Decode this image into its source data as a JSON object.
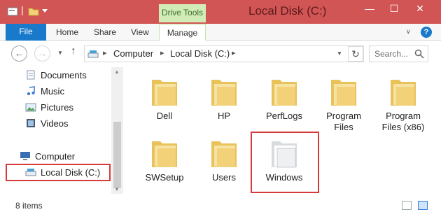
{
  "window": {
    "title": "Local Disk (C:)",
    "context_group": "Drive Tools",
    "accent": "#d25555"
  },
  "ribbon": {
    "file_label": "File",
    "tabs": [
      "Home",
      "Share",
      "View"
    ],
    "manage_label": "Manage"
  },
  "address": {
    "crumbs": [
      "Computer",
      "Local Disk (C:)"
    ],
    "search_placeholder": "Search..."
  },
  "navpane": {
    "items": [
      {
        "label": "Documents",
        "icon": "documents-icon"
      },
      {
        "label": "Music",
        "icon": "music-icon"
      },
      {
        "label": "Pictures",
        "icon": "pictures-icon"
      },
      {
        "label": "Videos",
        "icon": "videos-icon"
      },
      {
        "label": "Computer",
        "icon": "computer-icon"
      },
      {
        "label": "Local Disk (C:)",
        "icon": "drive-icon"
      }
    ]
  },
  "folders": [
    {
      "label": "Dell"
    },
    {
      "label": "HP"
    },
    {
      "label": "PerfLogs"
    },
    {
      "label": "Program\nFiles"
    },
    {
      "label": "Program\nFiles (x86)"
    },
    {
      "label": "SWSetup"
    },
    {
      "label": "Users"
    },
    {
      "label": "Windows"
    }
  ],
  "status": {
    "count_text": "8 items"
  }
}
